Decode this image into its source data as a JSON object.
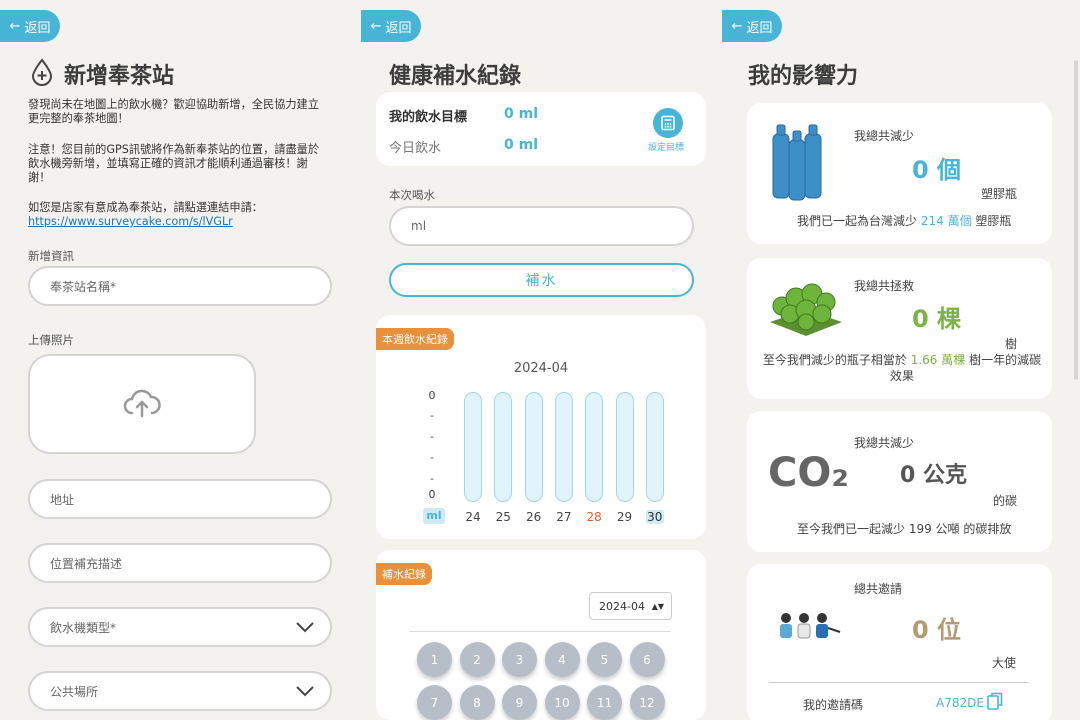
{
  "common": {
    "back_label": "返回"
  },
  "panel1": {
    "title": "新增奉茶站",
    "intro": "發現尚未在地圖上的飲水機？歡迎協助新增，全民協力建立更完整的奉茶地圖！",
    "notice": "注意！您目前的GPS訊號將作為新奉茶站的位置，請盡量於飲水機旁新增，並填寫正確的資訊才能順利通過審核！謝謝！",
    "store_prompt": "如您是店家有意成為奉茶站，請點選連結申請：",
    "store_link": "https://www.surveycake.com/s/lVGLr",
    "section_label": "新增資訊",
    "name_placeholder": "奉茶站名稱*",
    "photo_label": "上傳照片",
    "address_placeholder": "地址",
    "location_placeholder": "位置補充描述",
    "machine_type": "飲水機類型*",
    "place_type": "公共場所"
  },
  "panel2": {
    "title": "健康補水紀錄",
    "goal_label": "我的飲水目標",
    "goal_value": "0 ml",
    "today_label": "今日飲水",
    "today_value": "0 ml",
    "set_goal": "設定目標",
    "drink_label": "本次喝水",
    "drink_placeholder": "ml",
    "refill_button": "補水",
    "weekly_badge": "本週飲水紀錄",
    "log_badge": "補水紀錄",
    "month_select": "2024-04",
    "months": [
      "1",
      "2",
      "3",
      "4",
      "5",
      "6",
      "7",
      "8",
      "9",
      "10",
      "11",
      "12"
    ]
  },
  "chart_data": {
    "type": "bar",
    "title": "2024-04",
    "ylabel": "ml",
    "categories": [
      "24",
      "25",
      "26",
      "27",
      "28",
      "29",
      "30"
    ],
    "values": [
      0,
      0,
      0,
      0,
      0,
      0,
      0
    ],
    "y_ticks": [
      "0",
      "-",
      "-",
      "-",
      "-",
      "0"
    ],
    "highlight": {
      "28": "#e05a2b",
      "30": "#49b5d6"
    }
  },
  "panel3": {
    "title": "我的影響力",
    "bottles_label": "我總共減少",
    "bottles_value": "0 個",
    "bottles_unit": "塑膠瓶",
    "bottles_desc_a": "我們已一起為台灣減少",
    "bottles_desc_num": "214 萬個",
    "bottles_desc_b": "塑膠瓶",
    "trees_label": "我總共拯救",
    "trees_value": "0 棵",
    "trees_unit": "樹",
    "trees_desc_a": "至今我們減少的瓶子相當於",
    "trees_desc_num": "1.66 萬棵",
    "trees_desc_b": "樹一年的減碳效果",
    "co2_label": "我總共減少",
    "co2_value": "0 公克",
    "co2_unit": "的碳",
    "co2_icon_text": "CO₂",
    "co2_desc": "至今我們已一起減少 199 公噸 的碳排放",
    "invite_label": "總共邀請",
    "invite_value": "0 位",
    "invite_unit": "大使",
    "invite_code_label": "我的邀請碼",
    "invite_code": "A782DE"
  },
  "colors": {
    "accent": "#49b5d6",
    "orange": "#e8903a",
    "green": "#7cb342",
    "brown": "#b39a74"
  }
}
